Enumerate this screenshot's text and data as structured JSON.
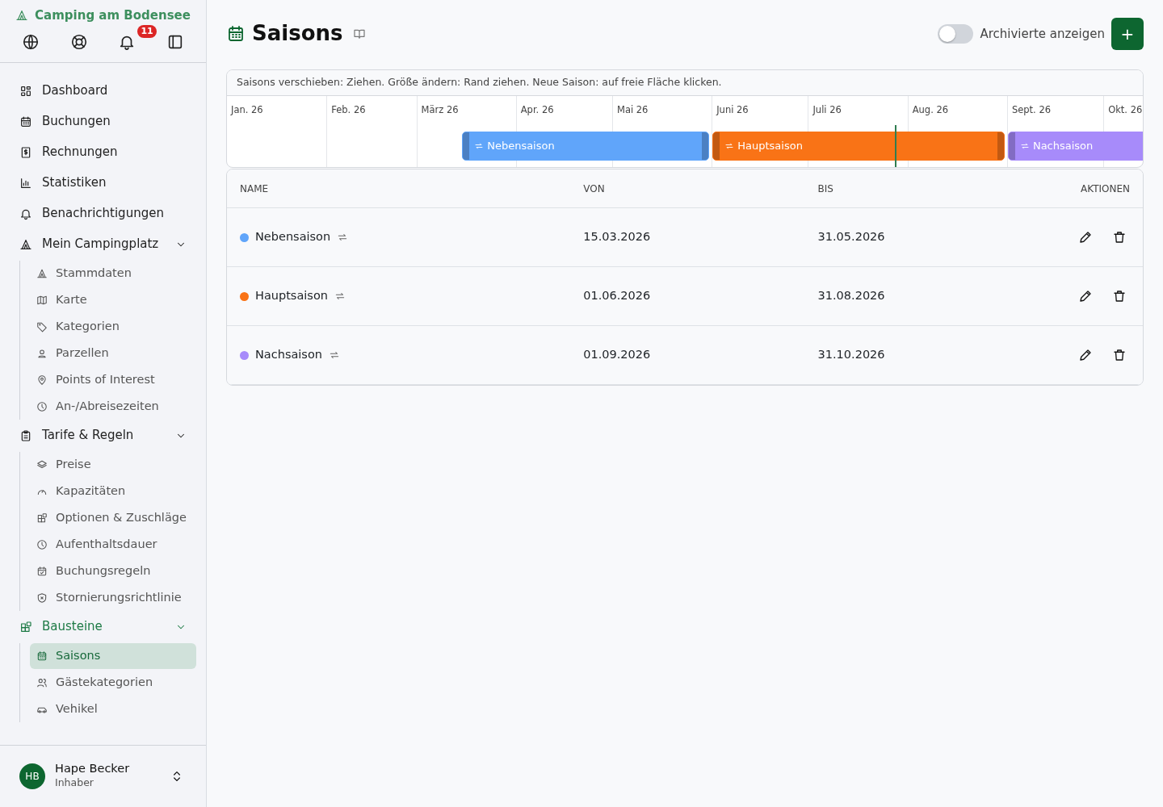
{
  "brand": {
    "name": "Camping am Bodensee"
  },
  "toolbar": [
    {
      "kind": "globe"
    },
    {
      "kind": "help"
    },
    {
      "kind": "bell",
      "badge": "11"
    },
    {
      "kind": "panel"
    }
  ],
  "nav": [
    {
      "kind": "link",
      "label": "Dashboard",
      "selected": false
    },
    {
      "kind": "link",
      "label": "Buchungen",
      "selected": false
    },
    {
      "kind": "link",
      "label": "Rechnungen",
      "selected": false
    },
    {
      "kind": "link",
      "label": "Statistiken",
      "selected": false
    },
    {
      "kind": "link",
      "label": "Benachrichtigungen",
      "selected": false
    },
    {
      "kind": "group",
      "label": "Mein Campingplatz",
      "selected": false,
      "expanded": true,
      "children": [
        {
          "label": "Stammdaten",
          "selected": false
        },
        {
          "label": "Karte",
          "selected": false
        },
        {
          "label": "Kategorien",
          "selected": false
        },
        {
          "label": "Parzellen",
          "selected": false
        },
        {
          "label": "Points of Interest",
          "selected": false
        },
        {
          "label": "An-/Abreisezeiten",
          "selected": false
        }
      ]
    },
    {
      "kind": "group",
      "label": "Tarife & Regeln",
      "selected": false,
      "expanded": true,
      "children": [
        {
          "label": "Preise",
          "selected": false
        },
        {
          "label": "Kapazitäten",
          "selected": false
        },
        {
          "label": "Optionen & Zuschläge",
          "selected": false
        },
        {
          "label": "Aufenthaltsdauer",
          "selected": false
        },
        {
          "label": "Buchungsregeln",
          "selected": false
        },
        {
          "label": "Stornierungsrichtlinie",
          "selected": false
        }
      ]
    },
    {
      "kind": "group",
      "label": "Bausteine",
      "selected": true,
      "expanded": true,
      "children": [
        {
          "label": "Saisons",
          "selected": true
        },
        {
          "label": "Gästekategorien",
          "selected": false
        },
        {
          "label": "Vehikel",
          "selected": false
        }
      ]
    }
  ],
  "user": {
    "initials": "HB",
    "name": "Hape Becker",
    "role": "Inhaber"
  },
  "header": {
    "title": "Saisons",
    "toggle": {
      "label": "Archivierte anzeigen",
      "on": false
    },
    "add_button": "+"
  },
  "timeline": {
    "hint": "Saisons verschieben: Ziehen. Größe ändern: Rand ziehen. Neue Saison: auf freie Fläche klicken.",
    "months": [
      "Jan. 26",
      "Feb. 26",
      "März 26",
      "Apr. 26",
      "Mai 26",
      "Juni 26",
      "Juli 26",
      "Aug. 26",
      "Sept. 26",
      "Okt. 26"
    ],
    "today_line": true,
    "bars": [
      {
        "label": "Nebensaison",
        "color": "#60a5fa",
        "recurring": true
      },
      {
        "label": "Hauptsaison",
        "color": "#f97316",
        "recurring": true
      },
      {
        "label": "Nachsaison",
        "color": "#a78bfa",
        "recurring": true
      }
    ]
  },
  "table": {
    "columns": [
      "NAME",
      "VON",
      "BIS",
      "AKTIONEN"
    ],
    "rows": [
      {
        "name": "Nebensaison",
        "color": "#60a5fa",
        "recurring": true,
        "from": "15.03.2026",
        "to": "31.05.2026"
      },
      {
        "name": "Hauptsaison",
        "color": "#f97316",
        "recurring": true,
        "from": "01.06.2026",
        "to": "31.08.2026"
      },
      {
        "name": "Nachsaison",
        "color": "#a78bfa",
        "recurring": true,
        "from": "01.09.2026",
        "to": "31.10.2026"
      }
    ]
  }
}
